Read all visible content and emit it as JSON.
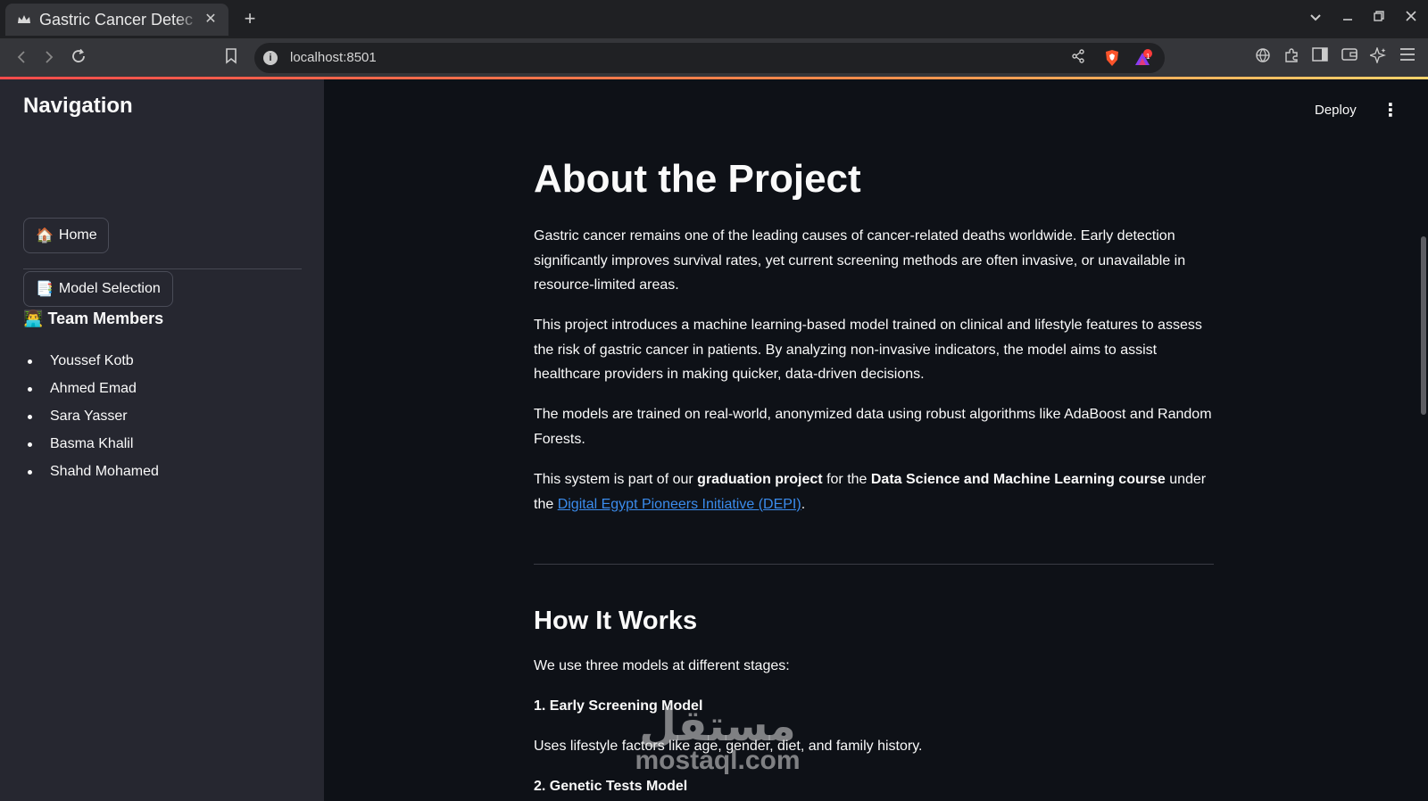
{
  "browser": {
    "tab_title": "Gastric Cancer Detec",
    "tab_close": "✕",
    "new_tab": "+",
    "url": "localhost:8501",
    "notification_count": "1"
  },
  "app": {
    "deploy_label": "Deploy",
    "menu_glyph": "⋮"
  },
  "sidebar": {
    "title": "Navigation",
    "buttons": [
      {
        "icon": "🏠",
        "label": "Home"
      },
      {
        "icon": "📑",
        "label": "Model Selection"
      }
    ],
    "team_icon": "👨‍💻",
    "team_title": "Team Members",
    "members": [
      "Youssef Kotb",
      "Ahmed Emad",
      "Sara Yasser",
      "Basma Khalil",
      "Shahd Mohamed"
    ]
  },
  "content": {
    "title": "About the Project",
    "para1": "Gastric cancer remains one of the leading causes of cancer-related deaths worldwide. Early detection significantly improves survival rates, yet current screening methods are often invasive, or unavailable in resource-limited areas.",
    "para2": "This project introduces a machine learning-based model trained on clinical and lifestyle features to assess the risk of gastric cancer in patients. By analyzing non-invasive indicators, the model aims to assist healthcare providers in making quicker, data-driven decisions.",
    "para3": "The models are trained on real-world, anonymized data using robust algorithms like AdaBoost and Random Forests.",
    "para4": {
      "t1": "This system is part of our ",
      "b1": "graduation project",
      "t2": " for the ",
      "b2": "Data Science and Machine Learning course",
      "t3": " under the ",
      "link": "Digital Egypt Pioneers Initiative (DEPI)",
      "t4": "."
    },
    "how_title": "How It Works",
    "how_intro": "We use three models at different stages:",
    "step1_title": "1. Early Screening Model",
    "step1_desc": "Uses lifestyle factors like age, gender, diet, and family history.",
    "step2_title": "2. Genetic Tests Model"
  },
  "watermark": {
    "arabic": "مستقل",
    "latin": "mostaql.com"
  },
  "colors": {
    "background": "#0e1117",
    "sidebar": "#262730",
    "link": "#3b8ced",
    "accent": "#ff4b4b"
  }
}
